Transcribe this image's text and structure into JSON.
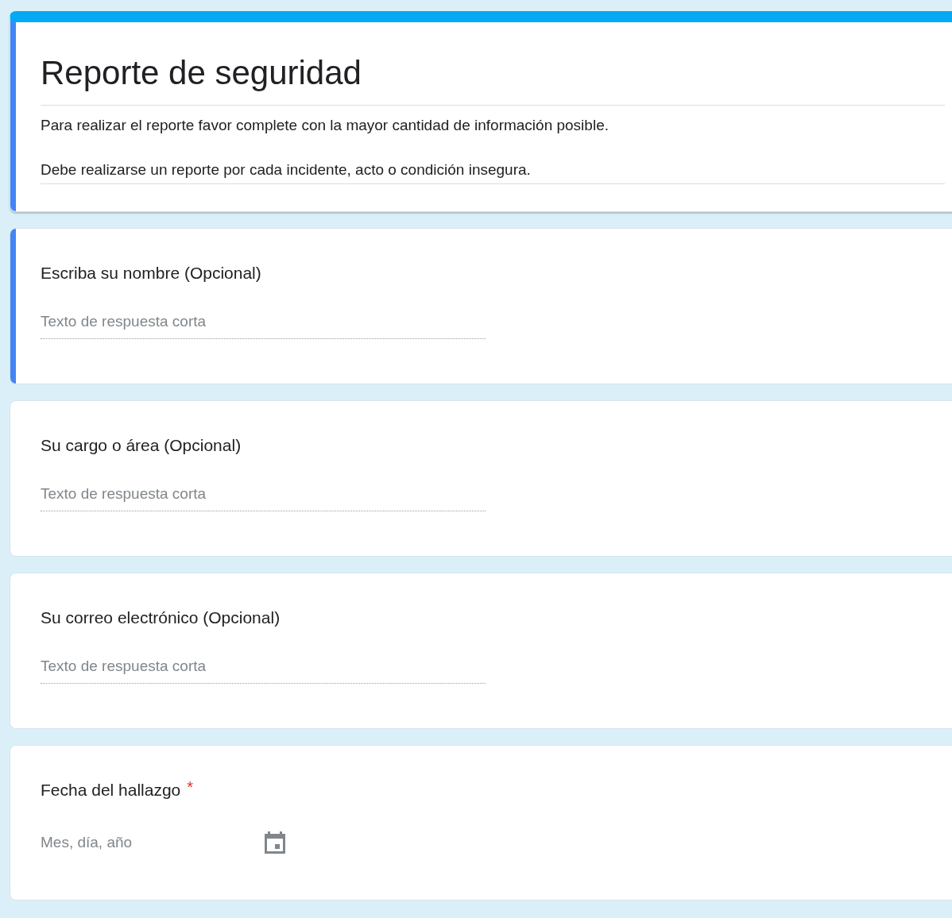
{
  "header": {
    "title": "Reporte de seguridad",
    "focused": true,
    "description": [
      "Para realizar el reporte favor complete con la mayor cantidad de información posible.",
      "Debe realizarse un reporte por cada incidente, acto o condición insegura."
    ]
  },
  "questions": [
    {
      "kind": "text",
      "title": "Escriba su nombre (Opcional)",
      "placeholder": "Texto de respuesta corta",
      "focused": true
    },
    {
      "kind": "text",
      "title": "Su cargo o área (Opcional)",
      "placeholder": "Texto de respuesta corta",
      "focused": false
    },
    {
      "kind": "text",
      "title": "Su correo electrónico (Opcional)",
      "placeholder": "Texto de respuesta corta",
      "focused": false
    },
    {
      "kind": "date",
      "title": "Fecha del hallazgo",
      "required_mark": "*",
      "placeholder": "Mes, día, año",
      "focused": false
    }
  ]
}
